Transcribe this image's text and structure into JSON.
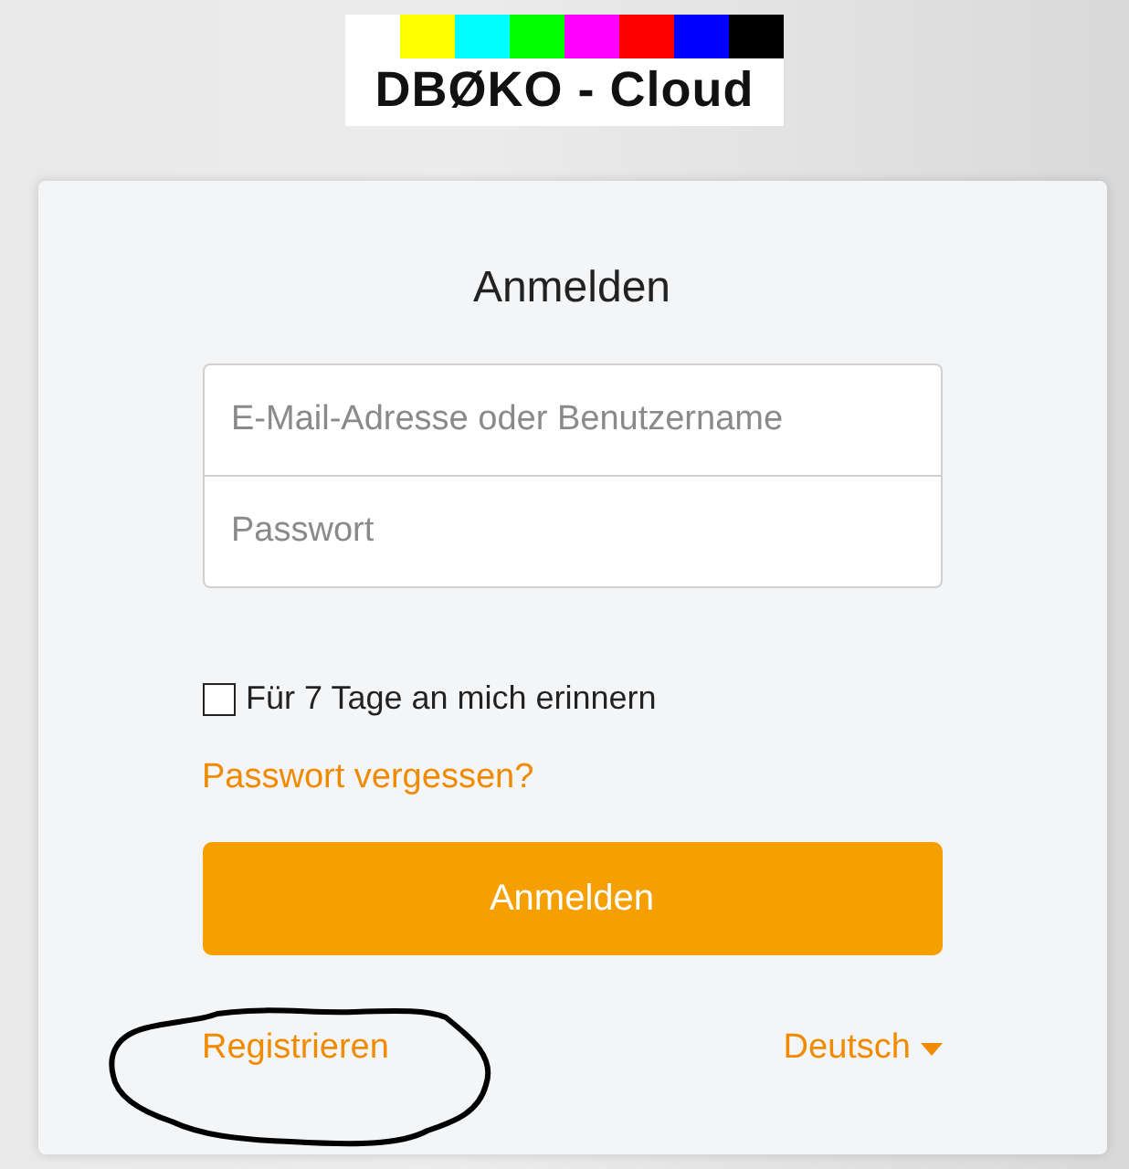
{
  "logo": {
    "text": "DBØKO - Cloud",
    "bars": [
      {
        "color": "#ffff00"
      },
      {
        "color": "#00ffff"
      },
      {
        "color": "#00ff00"
      },
      {
        "color": "#ff00ff"
      },
      {
        "color": "#ff0000"
      },
      {
        "color": "#0000ff"
      },
      {
        "color": "#000000"
      }
    ]
  },
  "login": {
    "title": "Anmelden",
    "fields": [
      {
        "placeholder": "E-Mail-Adresse oder Benutzername"
      },
      {
        "placeholder": "Passwort"
      }
    ],
    "remember": {
      "label": "Für 7 Tage an mich erinnern",
      "checked": false
    },
    "forgot_link": "Passwort vergessen?",
    "submit": "Anmelden",
    "register_link": "Registrieren",
    "language": "Deutsch"
  },
  "annotation": {
    "kind": "ellipse"
  }
}
